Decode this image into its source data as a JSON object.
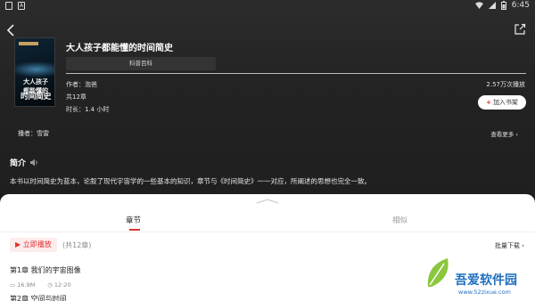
{
  "status_bar": {
    "icons_left": [
      "notification-icon",
      "app-icon"
    ],
    "time": "6:45"
  },
  "book": {
    "title": "大人孩子都能懂的时间简史",
    "tag": "科普百科",
    "author": "作者：泡爸",
    "chapters_total": "共12章",
    "duration": "时长：1.4 小时",
    "plays": "2.57万次播放",
    "cover_line1": "大人孩子",
    "cover_line2": "都能懂的",
    "cover_line3": "时间简史"
  },
  "actions": {
    "add_to_shelf": "加入书架"
  },
  "reader": {
    "label": "播者：雪雷",
    "see_more": "查看更多"
  },
  "intro": {
    "heading": "简介",
    "text": "本书以时间简史为蓝本，论叙了现代宇宙学的一些基本的知识，章节与《时间简史》一一对应，所阐述的思想也完全一致。"
  },
  "tabs": [
    {
      "label": "章节",
      "active": true
    },
    {
      "label": "相似",
      "active": false
    }
  ],
  "list_header": {
    "play_now": "立即播放",
    "count": "(共12章)",
    "batch_download": "批量下载"
  },
  "chapters": [
    {
      "title": "第1章 我们的宇宙图像",
      "size": "16.9M",
      "length": "12:20"
    },
    {
      "title": "第2章 空间与时间"
    }
  ],
  "watermark": {
    "line1": "吾爱软件园",
    "url": "www.52zixue.com"
  },
  "colors": {
    "accent": "#e03131",
    "hero_bg": "#232323",
    "sheet_bg": "#ffffff"
  }
}
